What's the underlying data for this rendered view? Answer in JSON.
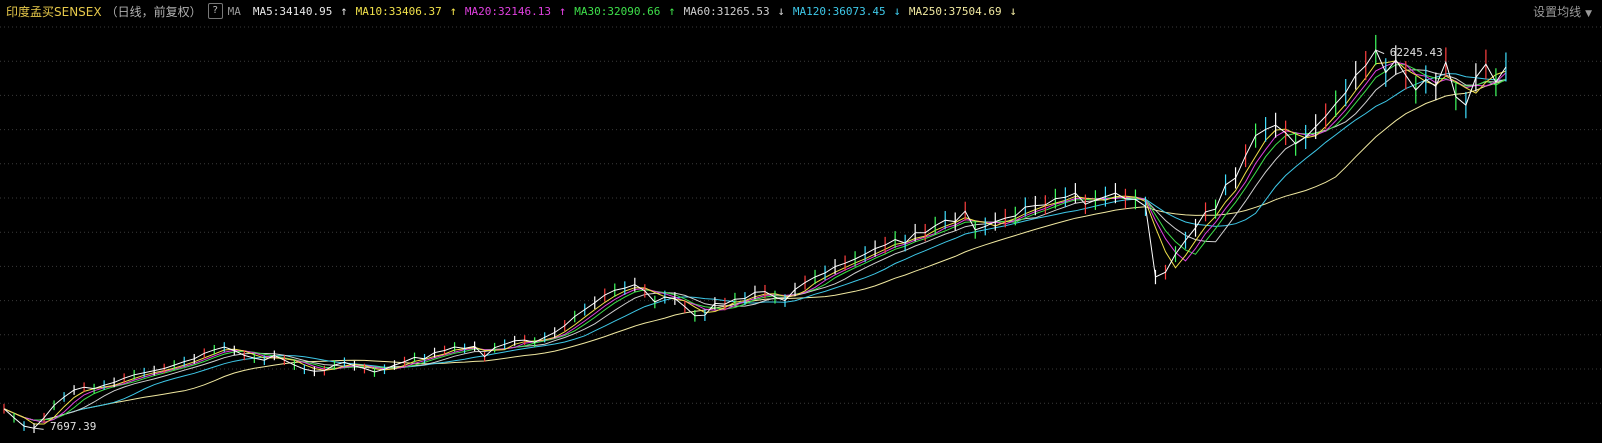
{
  "header": {
    "title": "印度孟买SENSEX",
    "subtitle": "（日线，前复权）",
    "help_label": "?",
    "ma_label": "MA",
    "settings_label": "设置均线"
  },
  "indicators": [
    {
      "label": "MA5:34140.95",
      "color": "#e8e8e8",
      "arrow": "↑"
    },
    {
      "label": "MA10:33406.37",
      "color": "#f0e04a",
      "arrow": "↑"
    },
    {
      "label": "MA20:32146.13",
      "color": "#e040e0",
      "arrow": "↑"
    },
    {
      "label": "MA30:32090.66",
      "color": "#3ee04a",
      "arrow": "↑"
    },
    {
      "label": "MA60:31265.53",
      "color": "#d0d0d0",
      "arrow": "↓"
    },
    {
      "label": "MA120:36073.45",
      "color": "#3ec8e8",
      "arrow": "↓"
    },
    {
      "label": "MA250:37504.69",
      "color": "#f0e8a0",
      "arrow": "↓"
    }
  ],
  "chart_data": {
    "type": "line",
    "title": "",
    "ylim": [
      7000,
      66000
    ],
    "gridlines": "dotted",
    "annotations": {
      "max_label": "62245.43",
      "min_label": "7697.39"
    },
    "x": [
      0,
      10,
      20,
      30,
      40,
      50,
      60,
      70,
      80,
      90,
      100,
      110,
      120,
      130,
      140,
      150,
      160,
      170,
      180,
      190,
      200,
      210,
      220,
      230,
      240,
      250,
      260,
      270,
      280,
      290,
      300,
      310,
      320,
      330,
      340,
      350,
      360,
      370,
      380,
      390,
      400,
      410,
      420,
      430,
      440,
      450,
      460,
      470,
      480,
      490,
      500,
      510,
      520,
      530,
      540,
      550,
      560,
      570,
      580,
      590,
      600,
      610,
      620,
      630,
      640,
      650,
      660,
      670,
      680,
      690,
      700,
      710,
      720,
      730,
      740,
      750,
      760,
      770,
      780,
      790,
      800,
      810,
      820,
      830,
      840,
      850,
      860,
      870,
      880,
      890,
      900,
      910,
      920,
      930,
      940,
      950,
      960,
      970,
      980,
      990,
      1000,
      1010,
      1020,
      1030,
      1040,
      1050,
      1060,
      1070,
      1080,
      1090,
      1100,
      1110,
      1120,
      1130,
      1140,
      1150,
      1160,
      1170,
      1180,
      1190,
      1200,
      1210,
      1220,
      1230,
      1240,
      1250,
      1260,
      1270,
      1280,
      1290,
      1300,
      1310,
      1320,
      1330,
      1340,
      1350,
      1360,
      1370,
      1380,
      1390,
      1400,
      1410,
      1420,
      1430,
      1440,
      1450,
      1460,
      1470,
      1480,
      1490,
      1500,
      1510,
      1520,
      1530,
      1540,
      1550,
      1560
    ],
    "series": [
      {
        "color": "#ffffff",
        "values": [
          10500,
          9200,
          8000,
          7697,
          9200,
          11000,
          12200,
          13200,
          13600,
          13400,
          13900,
          14300,
          14900,
          15400,
          15700,
          16000,
          16300,
          16800,
          17300,
          17700,
          18500,
          19000,
          19400,
          18900,
          18200,
          17800,
          17500,
          18200,
          17500,
          16800,
          16200,
          15900,
          16000,
          16800,
          17200,
          16700,
          16300,
          15800,
          16200,
          16800,
          17300,
          17900,
          17700,
          18600,
          18900,
          19400,
          19200,
          19500,
          18000,
          19300,
          19800,
          20300,
          20400,
          20100,
          20800,
          21500,
          22500,
          23800,
          24800,
          25800,
          26900,
          27600,
          27900,
          28400,
          27500,
          25900,
          26600,
          26400,
          25200,
          23900,
          24000,
          25700,
          25600,
          26300,
          26400,
          27300,
          27400,
          26600,
          26100,
          27700,
          28700,
          29500,
          30100,
          31000,
          31500,
          32100,
          32800,
          33600,
          34100,
          34900,
          34400,
          35900,
          35900,
          36900,
          37700,
          37500,
          39000,
          36300,
          36800,
          37500,
          38000,
          38300,
          39600,
          39800,
          39900,
          40800,
          41000,
          41600,
          40000,
          40600,
          41100,
          41600,
          40800,
          40700,
          39700,
          29500,
          30200,
          32800,
          34800,
          36600,
          38900,
          39300,
          42800,
          43800,
          47000,
          49900,
          50800,
          51400,
          50300,
          48700,
          49700,
          51200,
          52700,
          54500,
          56100,
          58600,
          60000,
          62245,
          59000,
          60800,
          58600,
          56500,
          58000,
          57000,
          60500,
          55500,
          54300,
          58300,
          60200,
          57600,
          59800
        ]
      }
    ]
  }
}
